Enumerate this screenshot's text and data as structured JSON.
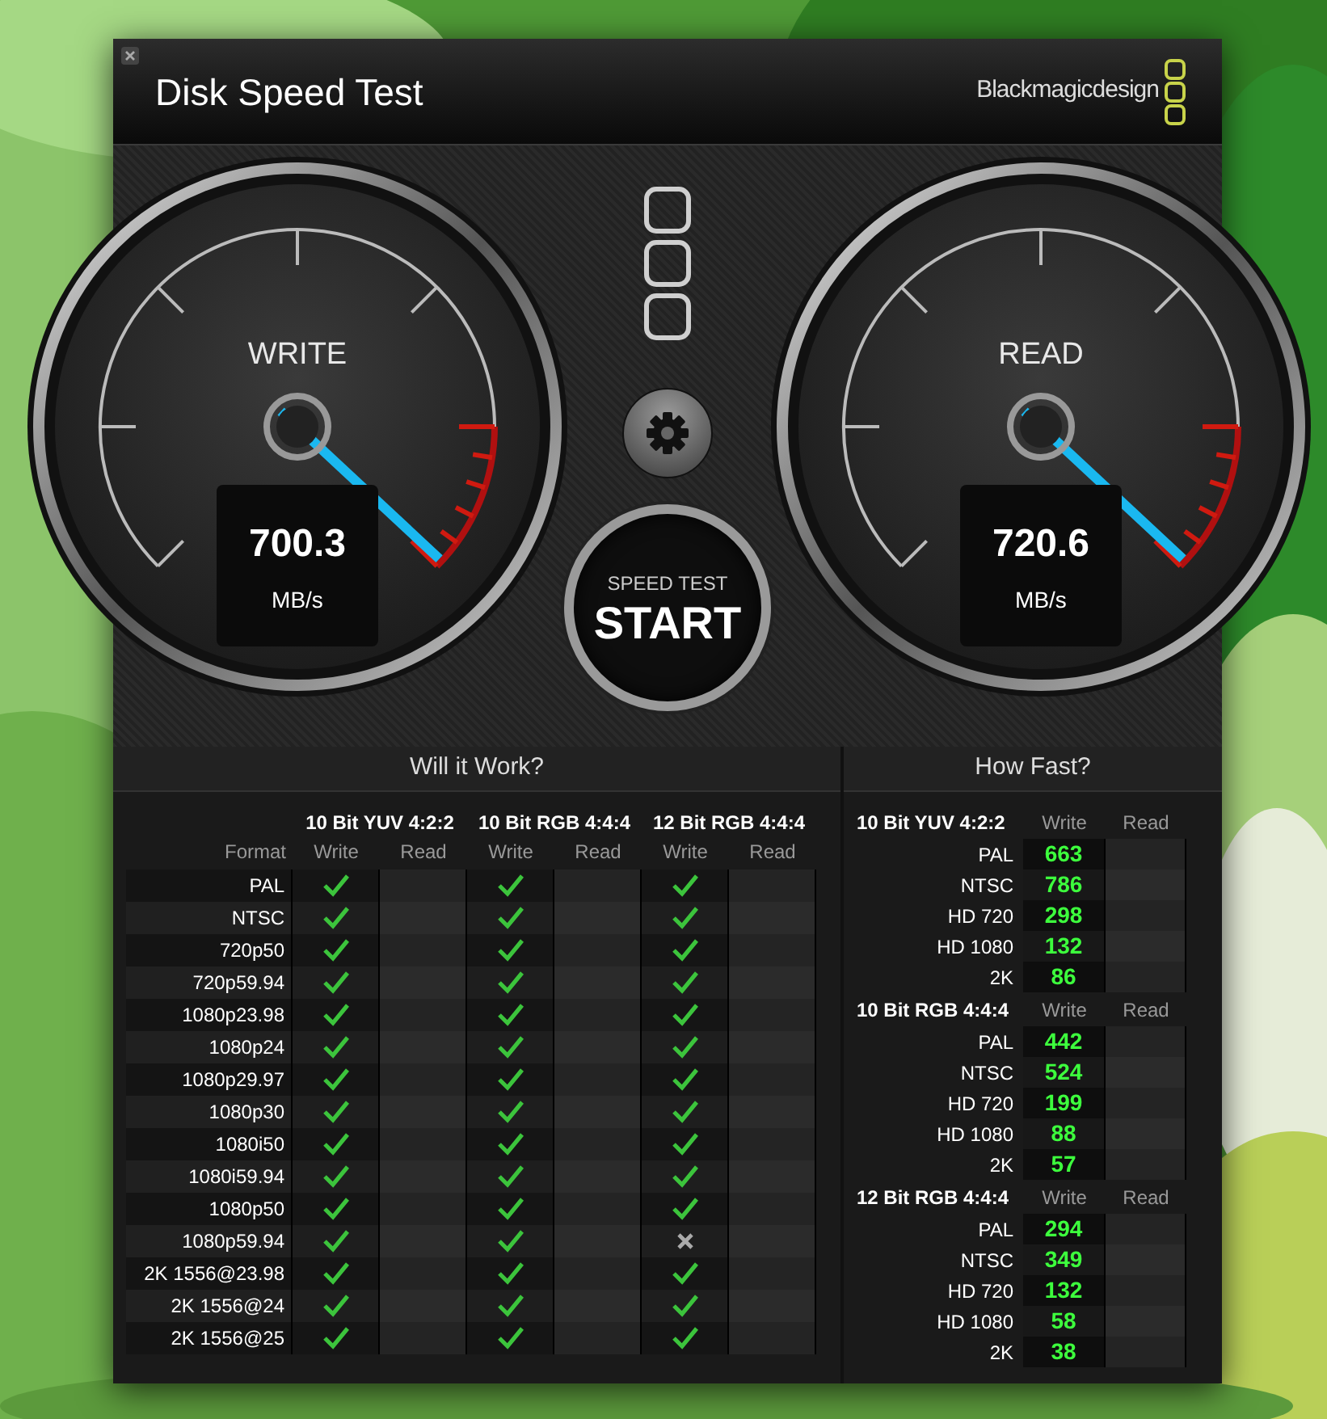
{
  "window": {
    "title": "Disk Speed Test",
    "logo_text": "Blackmagicdesign"
  },
  "gauges": [
    {
      "label": "WRITE",
      "value": "700.3",
      "unit": "MB/s"
    },
    {
      "label": "READ",
      "value": "720.6",
      "unit": "MB/s"
    }
  ],
  "start_button": {
    "caption": "SPEED TEST",
    "label": "START"
  },
  "will_it_work": {
    "title": "Will it Work?",
    "format_heading": "Format",
    "groups": [
      {
        "name": "10 Bit YUV 4:2:2",
        "write_heading": "Write",
        "read_heading": "Read"
      },
      {
        "name": "10 Bit RGB 4:4:4",
        "write_heading": "Write",
        "read_heading": "Read"
      },
      {
        "name": "12 Bit RGB 4:4:4",
        "write_heading": "Write",
        "read_heading": "Read"
      }
    ],
    "rows": [
      {
        "format": "PAL",
        "write_ok": [
          true,
          true,
          true
        ]
      },
      {
        "format": "NTSC",
        "write_ok": [
          true,
          true,
          true
        ]
      },
      {
        "format": "720p50",
        "write_ok": [
          true,
          true,
          true
        ]
      },
      {
        "format": "720p59.94",
        "write_ok": [
          true,
          true,
          true
        ]
      },
      {
        "format": "1080p23.98",
        "write_ok": [
          true,
          true,
          true
        ]
      },
      {
        "format": "1080p24",
        "write_ok": [
          true,
          true,
          true
        ]
      },
      {
        "format": "1080p29.97",
        "write_ok": [
          true,
          true,
          true
        ]
      },
      {
        "format": "1080p30",
        "write_ok": [
          true,
          true,
          true
        ]
      },
      {
        "format": "1080i50",
        "write_ok": [
          true,
          true,
          true
        ]
      },
      {
        "format": "1080i59.94",
        "write_ok": [
          true,
          true,
          true
        ]
      },
      {
        "format": "1080p50",
        "write_ok": [
          true,
          true,
          true
        ]
      },
      {
        "format": "1080p59.94",
        "write_ok": [
          true,
          true,
          false
        ]
      },
      {
        "format": "2K 1556@23.98",
        "write_ok": [
          true,
          true,
          true
        ]
      },
      {
        "format": "2K 1556@24",
        "write_ok": [
          true,
          true,
          true
        ]
      },
      {
        "format": "2K 1556@25",
        "write_ok": [
          true,
          true,
          true
        ]
      }
    ]
  },
  "how_fast": {
    "title": "How Fast?",
    "groups": [
      {
        "name": "10 Bit YUV 4:2:2",
        "write_heading": "Write",
        "read_heading": "Read",
        "rows": [
          {
            "format": "PAL",
            "write": "663"
          },
          {
            "format": "NTSC",
            "write": "786"
          },
          {
            "format": "HD 720",
            "write": "298"
          },
          {
            "format": "HD 1080",
            "write": "132"
          },
          {
            "format": "2K",
            "write": "86"
          }
        ]
      },
      {
        "name": "10 Bit RGB 4:4:4",
        "write_heading": "Write",
        "read_heading": "Read",
        "rows": [
          {
            "format": "PAL",
            "write": "442"
          },
          {
            "format": "NTSC",
            "write": "524"
          },
          {
            "format": "HD 720",
            "write": "199"
          },
          {
            "format": "HD 1080",
            "write": "88"
          },
          {
            "format": "2K",
            "write": "57"
          }
        ]
      },
      {
        "name": "12 Bit RGB 4:4:4",
        "write_heading": "Write",
        "read_heading": "Read",
        "rows": [
          {
            "format": "PAL",
            "write": "294"
          },
          {
            "format": "NTSC",
            "write": "349"
          },
          {
            "format": "HD 720",
            "write": "132"
          },
          {
            "format": "HD 1080",
            "write": "58"
          },
          {
            "format": "2K",
            "write": "38"
          }
        ]
      }
    ]
  }
}
